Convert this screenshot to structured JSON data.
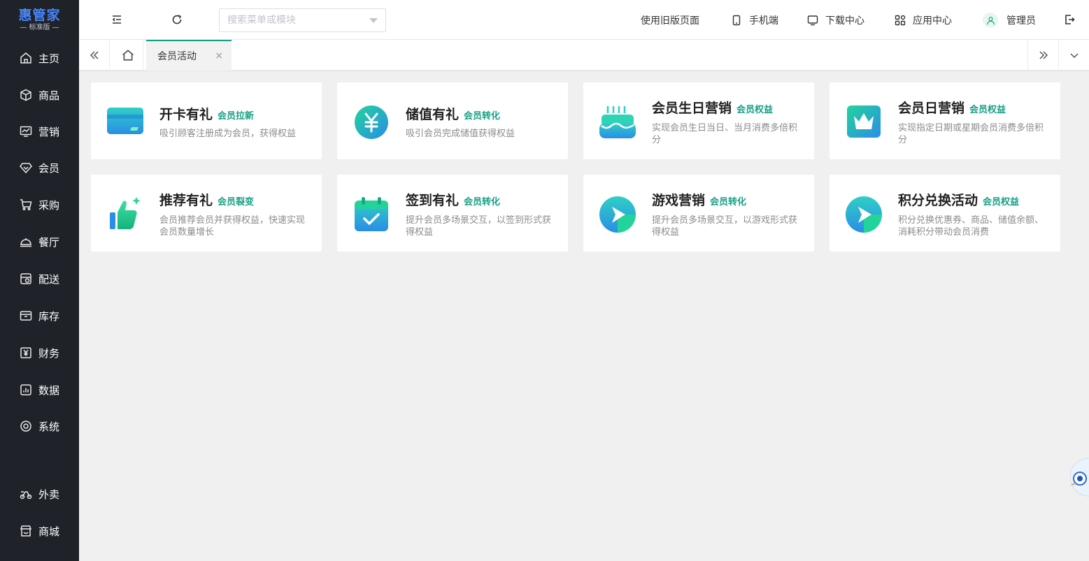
{
  "logo": {
    "title": "惠管家",
    "subtitle": "— 标准版 —"
  },
  "sidebar": {
    "items": [
      {
        "label": "主页",
        "icon": "home-icon"
      },
      {
        "label": "商品",
        "icon": "box-icon"
      },
      {
        "label": "营销",
        "icon": "chart-icon"
      },
      {
        "label": "会员",
        "icon": "diamond-icon"
      },
      {
        "label": "采购",
        "icon": "cart-icon"
      },
      {
        "label": "餐厅",
        "icon": "dish-icon"
      },
      {
        "label": "配送",
        "icon": "delivery-icon"
      },
      {
        "label": "库存",
        "icon": "inventory-icon"
      },
      {
        "label": "财务",
        "icon": "finance-icon"
      },
      {
        "label": "数据",
        "icon": "data-icon"
      },
      {
        "label": "系统",
        "icon": "settings-icon"
      },
      {
        "label": "外卖",
        "icon": "scooter-icon"
      },
      {
        "label": "商城",
        "icon": "store-icon"
      }
    ]
  },
  "header": {
    "search_placeholder": "搜索菜单或模块",
    "links": {
      "old_page": "使用旧版页面",
      "mobile": "手机端",
      "download": "下载中心",
      "apps": "应用中心",
      "admin": "管理员"
    }
  },
  "tabs": {
    "active": "会员活动",
    "close": "×"
  },
  "cards": [
    {
      "title": "开卡有礼",
      "tag": "会员拉新",
      "desc": "吸引顾客注册成为会员，获得权益",
      "icon": "card-icon"
    },
    {
      "title": "储值有礼",
      "tag": "会员转化",
      "desc": "吸引会员完成储值获得权益",
      "icon": "yuan-coin-icon"
    },
    {
      "title": "会员生日营销",
      "tag": "会员权益",
      "desc": "实现会员生日当日、当月消费多倍积分",
      "icon": "birthday-cake-icon"
    },
    {
      "title": "会员日营销",
      "tag": "会员权益",
      "desc": "实现指定日期或星期会员消费多倍积分",
      "icon": "crown-icon"
    },
    {
      "title": "推荐有礼",
      "tag": "会员裂变",
      "desc": "会员推荐会员并获得权益，快速实现会员数量增长",
      "icon": "thumbs-up-icon"
    },
    {
      "title": "签到有礼",
      "tag": "会员转化",
      "desc": "提升会员多场景交互，以签到形式获得权益",
      "icon": "calendar-check-icon"
    },
    {
      "title": "游戏营销",
      "tag": "会员转化",
      "desc": "提升会员多场景交互，以游戏形式获得权益",
      "icon": "play-arrow-icon"
    },
    {
      "title": "积分兑换活动",
      "tag": "会员权益",
      "desc": "积分兑换优惠券、商品、储值余额、消耗积分带动会员消费",
      "icon": "play-arrow-icon"
    }
  ]
}
